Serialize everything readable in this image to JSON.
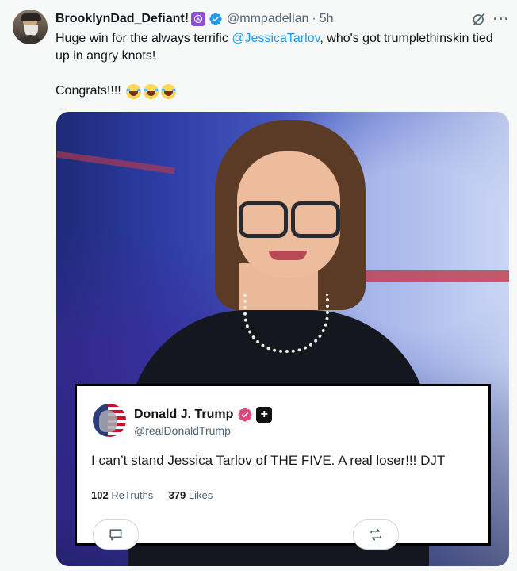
{
  "tweet": {
    "display_name": "BrooklynDad_Defiant!",
    "handle": "@mmpadellan",
    "separator": "·",
    "time": "5h",
    "text_before": "Huge win for the always terrific ",
    "mention": "@JessicaTarlov",
    "text_after": ", who's got trumplethinskin tied up in angry knots!",
    "congrats": "Congrats!!!!",
    "emoji": "face-with-tears-of-joy",
    "emoji_count": 3
  },
  "embed": {
    "name": "Donald J. Trump",
    "handle": "@realDonaldTrump",
    "text": "I can’t stand Jessica Tarlov of THE FIVE. A real loser!!! DJT",
    "retruths_count": "102",
    "retruths_label": "ReTruths",
    "likes_count": "379",
    "likes_label": "Likes",
    "plus_glyph": "+"
  },
  "icons": {
    "peace": "☮",
    "more": "···"
  },
  "colors": {
    "link": "#1d9bf0",
    "verified": "#1d9bf0",
    "truth_verified": "#e0457b",
    "peace_bg": "#8a4fd3",
    "muted": "#536471"
  }
}
